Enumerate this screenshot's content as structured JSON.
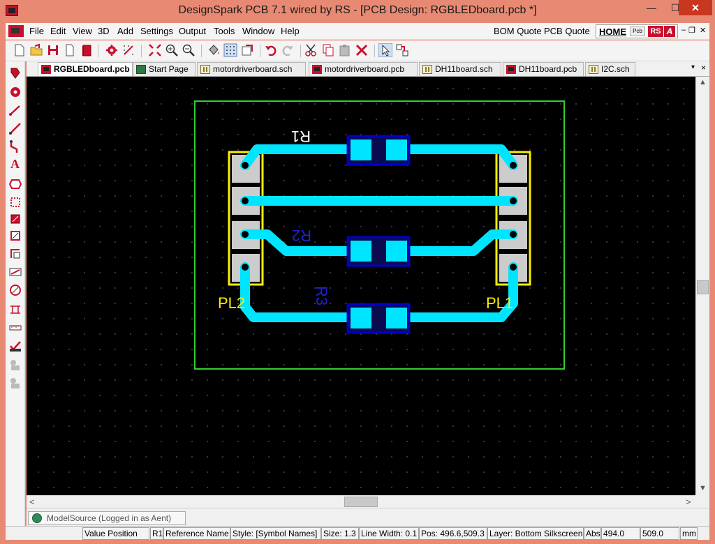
{
  "window": {
    "title": "DesignSpark PCB 7.1 wired by RS - [PCB Design: RGBLEDboard.pcb *]",
    "minimize": "—",
    "maximize": "☐",
    "close": "✕"
  },
  "menu": {
    "items": [
      "File",
      "Edit",
      "View",
      "3D",
      "Add",
      "Settings",
      "Output",
      "Tools",
      "Window",
      "Help"
    ],
    "bom_quote": "BOM Quote",
    "pcb_quote": "PCB Quote",
    "home": "HOME",
    "pcb_badge": "Pcb",
    "rs_badge": "RS",
    "a_badge": "A",
    "mdi_minimize": "–",
    "mdi_restore": "❐",
    "mdi_close": "✕"
  },
  "tabs": [
    {
      "label": "RGBLEDboard.pcb",
      "icon": "pcb-icon",
      "active": true
    },
    {
      "label": "Start Page",
      "icon": "start-page-icon",
      "active": false
    },
    {
      "label": "motordriverboard.sch",
      "icon": "schematic-icon",
      "active": false
    },
    {
      "label": "motordriverboard.pcb",
      "icon": "pcb-icon",
      "active": false
    },
    {
      "label": "DH11board.sch",
      "icon": "schematic-icon",
      "active": false
    },
    {
      "label": "DH11board.pcb",
      "icon": "pcb-icon",
      "active": false
    },
    {
      "label": "I2C.sch",
      "icon": "schematic-icon",
      "active": false
    }
  ],
  "tab_controls": {
    "menu": "▾",
    "close": "×"
  },
  "pcb": {
    "components": {
      "r1": "R1",
      "r2": "R2",
      "r3": "R3",
      "pl1": "PL1",
      "pl2": "PL2"
    },
    "colors": {
      "board_outline": "#33cc33",
      "track": "#00e5ff",
      "silkscreen": "#ffee00",
      "pad": "#00e5ff",
      "pad_outline": "#0000cc",
      "connector_pad": "#cccccc",
      "bottom_silk_text": "#2222cc",
      "top_silk_text": "#ffffff"
    }
  },
  "bottom_panel": {
    "modelsource": "ModelSource (Logged in as Aent)"
  },
  "statusbar": {
    "value_position": "Value Position",
    "ref": "R1",
    "reference_name": "Reference Name",
    "style": "Style: [Symbol Names]",
    "size": "Size: 1.3",
    "line_width": "Line Width: 0.1",
    "pos": "Pos: 496.6,509.3",
    "layer": "Layer: Bottom Silkscreen",
    "abs": "Abs",
    "x": "494.0",
    "y": "509.0",
    "units": "mm"
  },
  "scroll": {
    "up": "▲",
    "down": "▼",
    "left": "<",
    "right": ">"
  }
}
